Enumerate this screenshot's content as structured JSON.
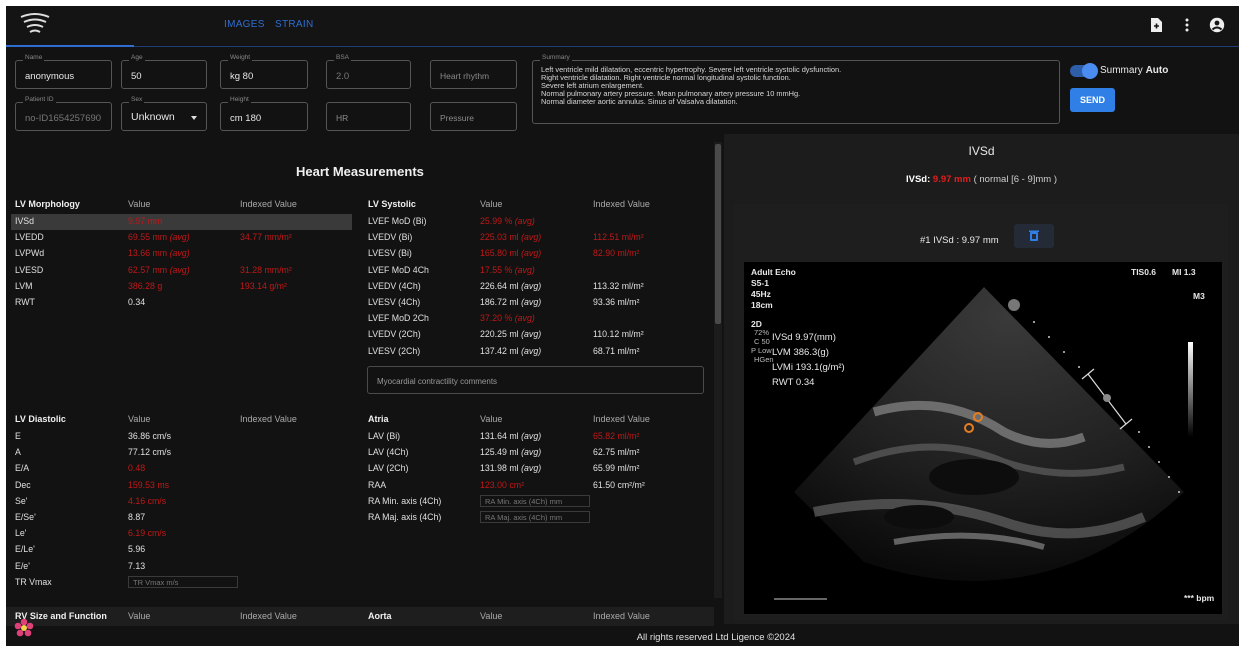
{
  "app": {
    "tabs": [
      {
        "label": "IMAGES"
      },
      {
        "label": "STRAIN"
      }
    ],
    "icons": {
      "logo": "wave-logo",
      "doc": "file-icon",
      "menu": "more-vert-icon",
      "account": "account-icon",
      "flower": "flower-icon"
    },
    "colors": {
      "accent": "#2f6dd0",
      "abnormal": "#c01818",
      "send": "#2f7fe6"
    }
  },
  "patient": {
    "name": {
      "label": "Name",
      "value": "anonymous"
    },
    "age": {
      "label": "Age",
      "value": "50"
    },
    "weight": {
      "label": "Weight",
      "value": "kg  80"
    },
    "bsa": {
      "label": "BSA",
      "value": "2.0"
    },
    "heart_rhythm": {
      "placeholder": "Heart rhythm"
    },
    "patient_id": {
      "label": "Patient ID",
      "value": "no-ID1654257690"
    },
    "sex": {
      "label": "Sex",
      "value": "Unknown"
    },
    "height": {
      "label": "Height",
      "value": "cm  180"
    },
    "hr": {
      "placeholder": "HR"
    },
    "pressure": {
      "placeholder": "Pressure"
    }
  },
  "summary": {
    "label": "Summary",
    "lines": [
      "Left ventricle mild dilatation, eccentric hypertrophy. Severe left ventricle systolic dysfunction.",
      "Right ventricle dilatation. Right ventricle normal longitudinal systolic function.",
      "Severe left atrium enlargement.",
      "Normal pulmonary artery pressure. Mean pulmonary artery pressure 10 mmHg.",
      "Normal diameter aortic annulus. Sinus of Valsalva dilatation."
    ],
    "auto_toggle_label": "Summary",
    "auto_toggle_state": "Auto",
    "auto_on": true,
    "send_label": "SEND"
  },
  "measurements": {
    "title": "Heart Measurements",
    "lv_morphology": {
      "headers": [
        "LV Morphology",
        "Value",
        "Indexed Value"
      ],
      "rows": [
        {
          "name": "IVSd",
          "value": "9.97 mm",
          "unit": "",
          "indexed": "",
          "indexed_unit": "",
          "value_abnormal": true,
          "indexed_abnormal": false
        },
        {
          "name": "LVEDD",
          "value": "69.55 mm",
          "unit": "(avg)",
          "indexed": "34.77 mm/m²",
          "indexed_unit": "",
          "value_abnormal": true,
          "indexed_abnormal": true
        },
        {
          "name": "LVPWd",
          "value": "13.66 mm",
          "unit": "(avg)",
          "indexed": "",
          "indexed_unit": "",
          "value_abnormal": true,
          "indexed_abnormal": false
        },
        {
          "name": "LVESD",
          "value": "62.57 mm",
          "unit": "(avg)",
          "indexed": "31.28 mm/m²",
          "indexed_unit": "",
          "value_abnormal": true,
          "indexed_abnormal": true
        },
        {
          "name": "LVM",
          "value": "386.28 g",
          "unit": "",
          "indexed": "193.14 g/m²",
          "indexed_unit": "",
          "value_abnormal": true,
          "indexed_abnormal": true
        },
        {
          "name": "RWT",
          "value": "0.34",
          "unit": "",
          "indexed": "",
          "indexed_unit": "",
          "value_abnormal": false,
          "indexed_abnormal": false
        }
      ]
    },
    "lv_systolic": {
      "headers": [
        "LV Systolic",
        "Value",
        "Indexed Value"
      ],
      "rows": [
        {
          "name": "LVEF MoD (Bi)",
          "value": "25.99 %",
          "unit": "(avg)",
          "indexed": "",
          "value_abnormal": true,
          "indexed_abnormal": false
        },
        {
          "name": "LVEDV (Bi)",
          "value": "225.03 ml",
          "unit": "(avg)",
          "indexed": "112.51 ml/m²",
          "value_abnormal": true,
          "indexed_abnormal": true
        },
        {
          "name": "LVESV (Bi)",
          "value": "165.80 ml",
          "unit": "(avg)",
          "indexed": "82.90 ml/m²",
          "value_abnormal": true,
          "indexed_abnormal": true
        },
        {
          "name": "LVEF MoD 4Ch",
          "value": "17.55 %",
          "unit": "(avg)",
          "indexed": "",
          "value_abnormal": true,
          "indexed_abnormal": false
        },
        {
          "name": "LVEDV (4Ch)",
          "value": "226.64 ml",
          "unit": "(avg)",
          "indexed": "113.32 ml/m²",
          "value_abnormal": false,
          "indexed_abnormal": false
        },
        {
          "name": "LVESV (4Ch)",
          "value": "186.72 ml",
          "unit": "(avg)",
          "indexed": "93.36 ml/m²",
          "value_abnormal": false,
          "indexed_abnormal": false
        },
        {
          "name": "LVEF MoD 2Ch",
          "value": "37.20 %",
          "unit": "(avg)",
          "indexed": "",
          "value_abnormal": true,
          "indexed_abnormal": false
        },
        {
          "name": "LVEDV (2Ch)",
          "value": "220.25 ml",
          "unit": "(avg)",
          "indexed": "110.12 ml/m²",
          "value_abnormal": false,
          "indexed_abnormal": false
        },
        {
          "name": "LVESV (2Ch)",
          "value": "137.42 ml",
          "unit": "(avg)",
          "indexed": "68.71 ml/m²",
          "value_abnormal": false,
          "indexed_abnormal": false
        }
      ],
      "comments_placeholder": "Myocardial contractility comments"
    },
    "lv_diastolic": {
      "headers": [
        "LV Diastolic",
        "Value",
        "Indexed Value"
      ],
      "rows": [
        {
          "name": "E",
          "value": "36.86 cm/s",
          "abnormal": false
        },
        {
          "name": "A",
          "value": "77.12 cm/s",
          "abnormal": false
        },
        {
          "name": "E/A",
          "value": "0.48",
          "abnormal": true
        },
        {
          "name": "Dec",
          "value": "159.53 ms",
          "abnormal": true
        },
        {
          "name": "Se'",
          "value": "4.16 cm/s",
          "abnormal": true
        },
        {
          "name": "E/Se'",
          "value": "8.87",
          "abnormal": false
        },
        {
          "name": "Le'",
          "value": "6.19 cm/s",
          "abnormal": true
        },
        {
          "name": "E/Le'",
          "value": "5.96",
          "abnormal": false
        },
        {
          "name": "E/e'",
          "value": "7.13",
          "abnormal": false
        }
      ],
      "tr_vmax": {
        "name": "TR Vmax",
        "placeholder": "TR Vmax m/s"
      }
    },
    "atria": {
      "headers": [
        "Atria",
        "Value",
        "Indexed Value"
      ],
      "rows": [
        {
          "name": "LAV (Bi)",
          "value": "131.64 ml",
          "unit": "(avg)",
          "indexed": "65.82 ml/m²",
          "value_abnormal": false,
          "indexed_abnormal": true
        },
        {
          "name": "LAV (4Ch)",
          "value": "125.49 ml",
          "unit": "(avg)",
          "indexed": "62.75 ml/m²",
          "value_abnormal": false,
          "indexed_abnormal": false
        },
        {
          "name": "LAV (2Ch)",
          "value": "131.98 ml",
          "unit": "(avg)",
          "indexed": "65.99 ml/m²",
          "value_abnormal": false,
          "indexed_abnormal": false
        },
        {
          "name": "RAA",
          "value": "123.00 cm²",
          "unit": "",
          "indexed": "61.50 cm²/m²",
          "value_abnormal": true,
          "indexed_abnormal": false
        }
      ],
      "inputs": [
        {
          "name": "RA Min. axis (4Ch)",
          "placeholder": "RA Min. axis (4Ch) mm"
        },
        {
          "name": "RA Maj. axis (4Ch)",
          "placeholder": "RA Maj. axis (4Ch) mm"
        }
      ]
    },
    "rv": {
      "headers": [
        "RV Size and Function",
        "Value",
        "Indexed Value"
      ]
    },
    "aorta": {
      "headers": [
        "Aorta",
        "Value",
        "Indexed Value"
      ]
    }
  },
  "viewer": {
    "title": "IVSd",
    "sub_label": "IVSd:",
    "sub_value": "9.97 mm",
    "sub_range": "( normal [6 - 9]mm )",
    "measurement_label": "#1 IVSd : 9.97 mm",
    "echo": {
      "mode": "Adult Echo",
      "probe": "S5-1",
      "freq": "45Hz",
      "depth": "18cm",
      "tis": "TIS0.6",
      "mi": "MI 1.3",
      "map": "M3",
      "mode2d": "2D",
      "params": [
        "72%",
        "C 50",
        "P Low",
        "HGen"
      ],
      "overlay": [
        "IVSd 9.97(mm)",
        "LVM 386.3(g)",
        "LVMi 193.1(g/m²)",
        "RWT 0.34"
      ],
      "bpm": "*** bpm"
    }
  },
  "footer": {
    "text": "All rights reserved Ltd Ligence ©2024"
  }
}
